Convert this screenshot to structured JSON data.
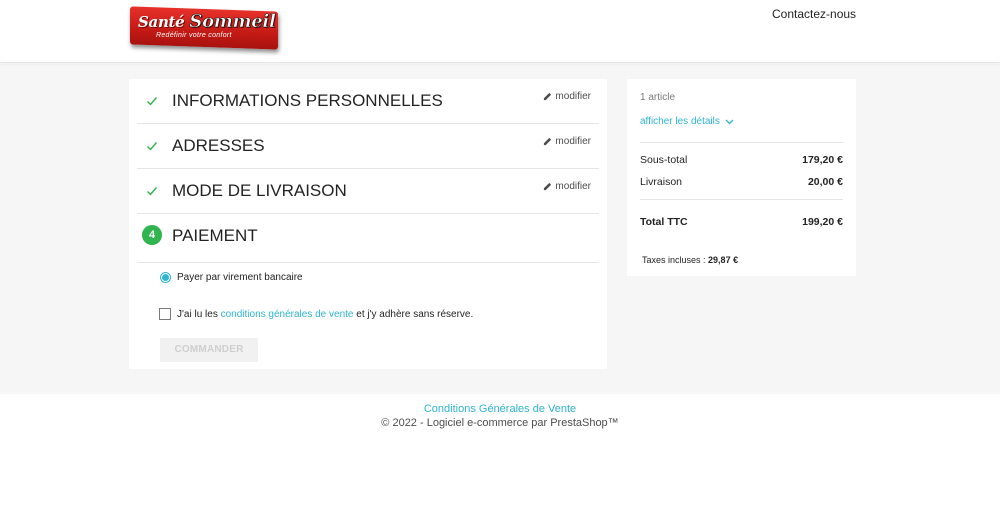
{
  "header": {
    "logo": {
      "brand_part1": "Santé",
      "brand_part2": "Sommeil",
      "tagline": "Redéfinir votre confort"
    },
    "contact_label": "Contactez-nous"
  },
  "checkout": {
    "steps": [
      {
        "title": "Informations personnelles",
        "status": "complete",
        "edit_label": "modifier"
      },
      {
        "title": "Adresses",
        "status": "complete",
        "edit_label": "modifier"
      },
      {
        "title": "Mode de livraison",
        "status": "complete",
        "edit_label": "modifier"
      },
      {
        "number": "4",
        "title": "Paiement",
        "status": "current"
      }
    ],
    "payment_option_label": "Payer par virement bancaire",
    "terms": {
      "prefix": "J'ai lu les",
      "link": "conditions générales de vente",
      "suffix": "et j'y adhère sans réserve."
    },
    "order_button_label": "Commander"
  },
  "summary": {
    "item_count": "1 article",
    "details_label": "afficher les détails",
    "subtotal": {
      "label": "Sous-total",
      "value": "179,20 €"
    },
    "shipping": {
      "label": "Livraison",
      "value": "20,00 €"
    },
    "total": {
      "label": "Total TTC",
      "value": "199,20 €"
    },
    "taxes": {
      "label": "Taxes incluses :",
      "value": "29,87 €"
    }
  },
  "footer": {
    "cgv_link": "Conditions Générales de Vente",
    "copyright": "© 2022 - Logiciel e-commerce par PrestaShop™"
  },
  "colors": {
    "accent": "#2fb5d2",
    "success": "#2fb44f",
    "background": "#f6f6f6",
    "logo_red": "#d42a24"
  }
}
